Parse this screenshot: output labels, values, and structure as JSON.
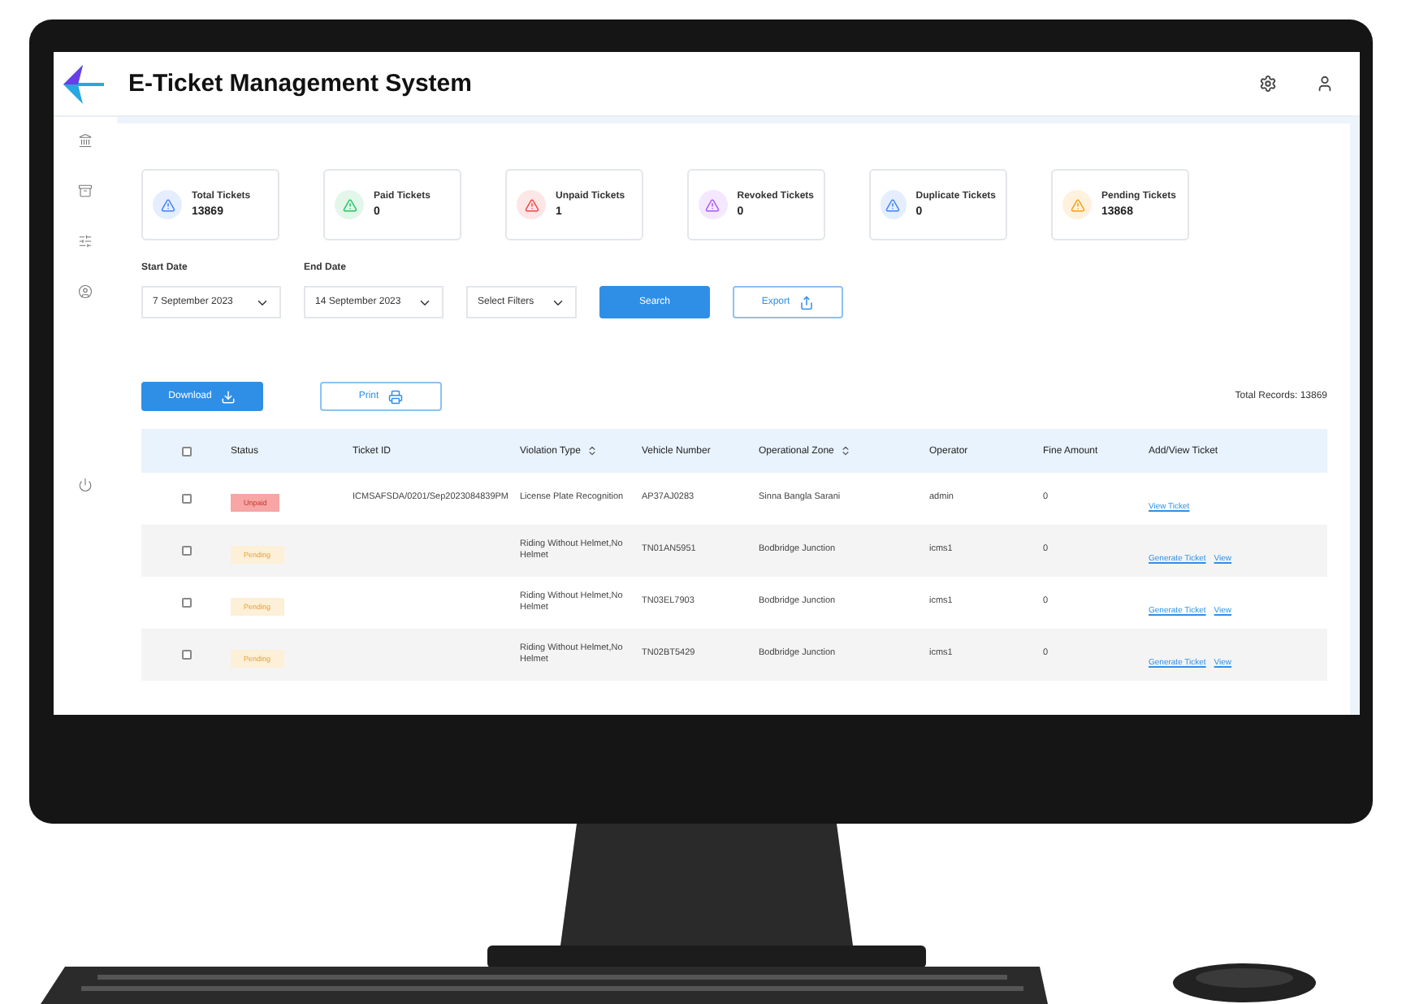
{
  "header": {
    "title": "E-Ticket Management System"
  },
  "stat_cards": [
    {
      "label": "Total Tickets",
      "value": "13869",
      "color": "#3b82f6"
    },
    {
      "label": "Paid Tickets",
      "value": "0",
      "color": "#22c55e"
    },
    {
      "label": "Unpaid Tickets",
      "value": "1",
      "color": "#ef4444"
    },
    {
      "label": "Revoked Tickets",
      "value": "0",
      "color": "#a855f7"
    },
    {
      "label": "Duplicate Tickets",
      "value": "0",
      "color": "#3b82f6"
    },
    {
      "label": "Pending Tickets",
      "value": "13868",
      "color": "#f59e0b"
    }
  ],
  "filters": {
    "start_date": {
      "label": "Start Date",
      "value": "7 September 2023"
    },
    "end_date": {
      "label": "End Date",
      "value": "14 September 2023"
    },
    "select": {
      "placeholder": "Select Filters"
    },
    "search_button": "Search",
    "export_button": "Export"
  },
  "actions": {
    "download_button": "Download",
    "print_button": "Print",
    "total_records": "Total Records: 13869"
  },
  "table": {
    "header_checked": false,
    "columns": [
      {
        "label": "Status",
        "sortable": false
      },
      {
        "label": "Ticket ID",
        "sortable": false
      },
      {
        "label": "Violation Type",
        "sortable": true
      },
      {
        "label": "Vehicle Number",
        "sortable": false
      },
      {
        "label": "Operational Zone",
        "sortable": true
      },
      {
        "label": "Operator",
        "sortable": false
      },
      {
        "label": "Fine Amount",
        "sortable": false
      },
      {
        "label": "Add/View Ticket",
        "sortable": false
      }
    ],
    "rows": [
      {
        "checked": false,
        "status": {
          "label": "Unpaid",
          "kind": "unpaid"
        },
        "ticket_id": "ICMSAFSDA/0201/Sep2023084839PM",
        "violation": "License Plate Recognition",
        "vehicle": "AP37AJ0283",
        "zone": "Sinna Bangla Sarani",
        "operator": "admin",
        "fine": "0",
        "links": [
          "View Ticket"
        ]
      },
      {
        "checked": false,
        "status": {
          "label": "Pending",
          "kind": "pending"
        },
        "ticket_id": "",
        "violation": "Riding Without Helmet,No Helmet",
        "vehicle": "TN01AN5951",
        "zone": "Bodbridge Junction",
        "operator": "icms1",
        "fine": "0",
        "links": [
          "Generate Ticket",
          "View"
        ]
      },
      {
        "checked": false,
        "status": {
          "label": "Pending",
          "kind": "pending"
        },
        "ticket_id": "",
        "violation": "Riding Without Helmet,No Helmet",
        "vehicle": "TN03EL7903",
        "zone": "Bodbridge Junction",
        "operator": "icms1",
        "fine": "0",
        "links": [
          "Generate Ticket",
          "View"
        ]
      },
      {
        "checked": false,
        "status": {
          "label": "Pending",
          "kind": "pending"
        },
        "ticket_id": "",
        "violation": "Riding Without Helmet,No Helmet",
        "vehicle": "TN02BT5429",
        "zone": "Bodbridge Junction",
        "operator": "icms1",
        "fine": "0",
        "links": [
          "Generate Ticket",
          "View"
        ]
      }
    ]
  }
}
